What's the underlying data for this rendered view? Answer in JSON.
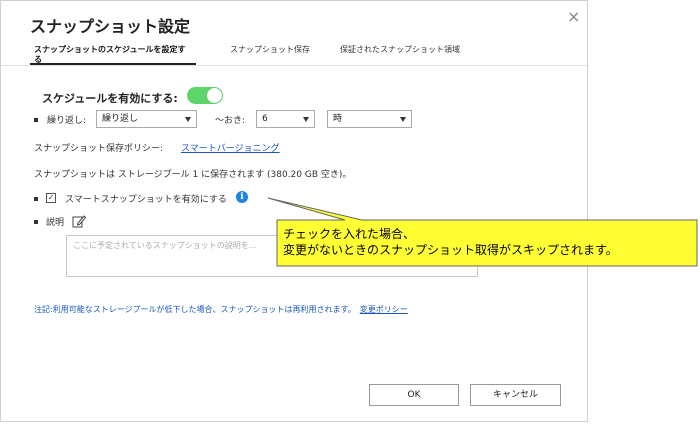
{
  "dialog": {
    "title": "スナップショット設定",
    "close_glyph": "×"
  },
  "tabs": [
    {
      "label_line1": "スナップショットのスケジュールを設定す",
      "label_line2": "る"
    },
    {
      "label": "スナップショット保存"
    },
    {
      "label": "保証されたスナップショット領域"
    }
  ],
  "schedule": {
    "label": "スケジュールを有効にする:",
    "enabled": true,
    "repeat_label": "繰り返し:",
    "repeat_value": "繰り返し",
    "every_label": "～おき:",
    "interval_value": "6",
    "unit_value": "時"
  },
  "retention": {
    "label": "スナップショット保存ポリシー:",
    "link": "スマートバージョニング"
  },
  "storage_note": "スナップショットは ストレージプール 1 に保存されます (380.20 GB 空き)。",
  "smart_snapshot": {
    "checked": true,
    "check_glyph": "✓",
    "label": "スマートスナップショットを有効にする",
    "info_glyph": "i"
  },
  "description": {
    "label": "説明",
    "placeholder": "ここに予定されているスナップショットの説明を..."
  },
  "footer_note": {
    "text": "注記:利用可能なストレージプールが低下した場合、スナップショットは再利用されます。",
    "link": "変更ポリシー"
  },
  "buttons": {
    "ok": "OK",
    "cancel": "キャンセル"
  },
  "callout": {
    "line1": "チェックを入れた場合、",
    "line2": "変更がないときのスナップショット取得がスキップされます。",
    "fill_color": "#ffff33"
  },
  "colors": {
    "toggle_on": "#5cd66a",
    "link": "#1a56c4",
    "info": "#1e86e0"
  }
}
